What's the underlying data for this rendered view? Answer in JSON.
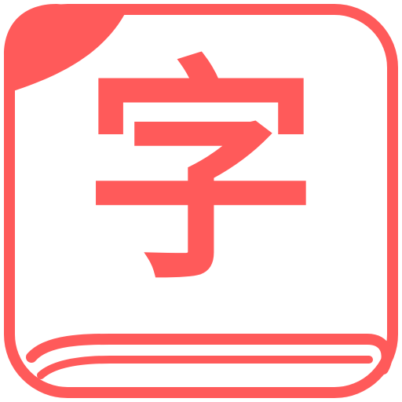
{
  "app_icon": {
    "glyph": "字",
    "colors": {
      "accent": "#FF5A5A",
      "background": "#FFFFFF"
    },
    "icon_names": [
      "book-icon",
      "bookmark-corner-icon",
      "chinese-character-zi-icon"
    ]
  }
}
